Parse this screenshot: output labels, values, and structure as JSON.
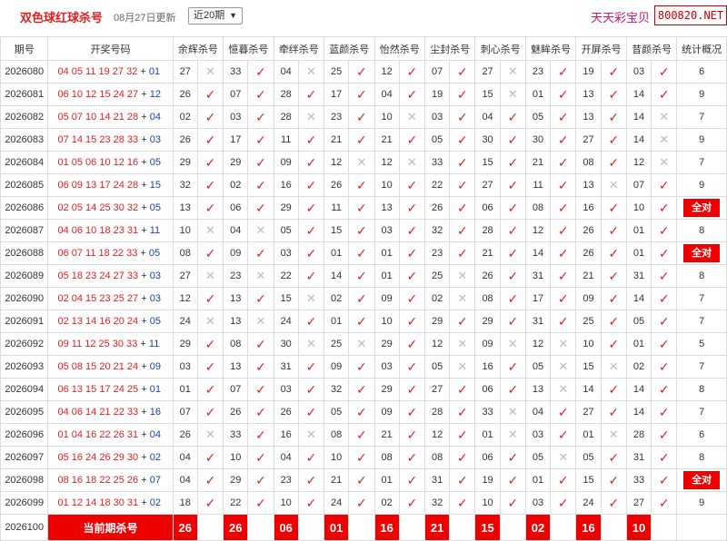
{
  "header": {
    "title": "双色球红球杀号",
    "updated": "08月27日更新",
    "range_selected": "近20期",
    "brand": "天天彩宝贝",
    "site": "800820.NET"
  },
  "columns": {
    "issue": "期号",
    "draw": "开奖号码",
    "experts": [
      "余辉杀号",
      "憶暮杀号",
      "牵绊杀号",
      "蓝颜杀号",
      "怡然杀号",
      "尘封杀号",
      "刺心杀号",
      "魅眸杀号",
      "开屏杀号",
      "昔颜杀号"
    ],
    "stat": "统计概况"
  },
  "rows": [
    {
      "issue": "2026080",
      "red": "04 05 11 19 27 32",
      "blue": "01",
      "kills": [
        [
          "27",
          "x"
        ],
        [
          "33",
          "v"
        ],
        [
          "04",
          "x"
        ],
        [
          "25",
          "v"
        ],
        [
          "12",
          "v"
        ],
        [
          "07",
          "v"
        ],
        [
          "27",
          "x"
        ],
        [
          "23",
          "v"
        ],
        [
          "19",
          "v"
        ],
        [
          "03",
          "v"
        ]
      ],
      "stat": "6"
    },
    {
      "issue": "2026081",
      "red": "06 10 12 15 24 27",
      "blue": "12",
      "kills": [
        [
          "26",
          "v"
        ],
        [
          "07",
          "v"
        ],
        [
          "28",
          "v"
        ],
        [
          "17",
          "v"
        ],
        [
          "04",
          "v"
        ],
        [
          "19",
          "v"
        ],
        [
          "15",
          "x"
        ],
        [
          "01",
          "v"
        ],
        [
          "13",
          "v"
        ],
        [
          "14",
          "v"
        ]
      ],
      "stat": "9"
    },
    {
      "issue": "2026082",
      "red": "05 07 10 14 21 28",
      "blue": "04",
      "kills": [
        [
          "02",
          "v"
        ],
        [
          "03",
          "v"
        ],
        [
          "28",
          "x"
        ],
        [
          "23",
          "v"
        ],
        [
          "10",
          "x"
        ],
        [
          "03",
          "v"
        ],
        [
          "04",
          "v"
        ],
        [
          "05",
          "v"
        ],
        [
          "13",
          "v"
        ],
        [
          "14",
          "x"
        ]
      ],
      "stat": "7"
    },
    {
      "issue": "2026083",
      "red": "07 14 15 23 28 33",
      "blue": "03",
      "kills": [
        [
          "26",
          "v"
        ],
        [
          "17",
          "v"
        ],
        [
          "11",
          "v"
        ],
        [
          "21",
          "v"
        ],
        [
          "21",
          "v"
        ],
        [
          "05",
          "v"
        ],
        [
          "30",
          "v"
        ],
        [
          "30",
          "v"
        ],
        [
          "27",
          "v"
        ],
        [
          "14",
          "x"
        ]
      ],
      "stat": "9"
    },
    {
      "issue": "2026084",
      "red": "01 05 06 10 12 16",
      "blue": "05",
      "kills": [
        [
          "29",
          "v"
        ],
        [
          "29",
          "v"
        ],
        [
          "09",
          "v"
        ],
        [
          "12",
          "x"
        ],
        [
          "12",
          "x"
        ],
        [
          "33",
          "v"
        ],
        [
          "15",
          "v"
        ],
        [
          "21",
          "v"
        ],
        [
          "08",
          "v"
        ],
        [
          "12",
          "x"
        ]
      ],
      "stat": "7"
    },
    {
      "issue": "2026085",
      "red": "06 09 13 17 24 28",
      "blue": "15",
      "kills": [
        [
          "32",
          "v"
        ],
        [
          "02",
          "v"
        ],
        [
          "16",
          "v"
        ],
        [
          "26",
          "v"
        ],
        [
          "10",
          "v"
        ],
        [
          "22",
          "v"
        ],
        [
          "27",
          "v"
        ],
        [
          "11",
          "v"
        ],
        [
          "13",
          "x"
        ],
        [
          "07",
          "v"
        ]
      ],
      "stat": "9"
    },
    {
      "issue": "2026086",
      "red": "02 05 14 25 30 32",
      "blue": "05",
      "kills": [
        [
          "13",
          "v"
        ],
        [
          "06",
          "v"
        ],
        [
          "29",
          "v"
        ],
        [
          "11",
          "v"
        ],
        [
          "13",
          "v"
        ],
        [
          "26",
          "v"
        ],
        [
          "06",
          "v"
        ],
        [
          "08",
          "v"
        ],
        [
          "16",
          "v"
        ],
        [
          "10",
          "v"
        ]
      ],
      "stat": "全对"
    },
    {
      "issue": "2026087",
      "red": "04 06 10 18 23 31",
      "blue": "11",
      "kills": [
        [
          "10",
          "x"
        ],
        [
          "04",
          "x"
        ],
        [
          "05",
          "v"
        ],
        [
          "15",
          "v"
        ],
        [
          "03",
          "v"
        ],
        [
          "32",
          "v"
        ],
        [
          "28",
          "v"
        ],
        [
          "12",
          "v"
        ],
        [
          "26",
          "v"
        ],
        [
          "01",
          "v"
        ]
      ],
      "stat": "8"
    },
    {
      "issue": "2026088",
      "red": "06 07 11 18 22 33",
      "blue": "05",
      "kills": [
        [
          "08",
          "v"
        ],
        [
          "09",
          "v"
        ],
        [
          "03",
          "v"
        ],
        [
          "01",
          "v"
        ],
        [
          "01",
          "v"
        ],
        [
          "23",
          "v"
        ],
        [
          "21",
          "v"
        ],
        [
          "14",
          "v"
        ],
        [
          "26",
          "v"
        ],
        [
          "01",
          "v"
        ]
      ],
      "stat": "全对"
    },
    {
      "issue": "2026089",
      "red": "05 18 23 24 27 33",
      "blue": "03",
      "kills": [
        [
          "27",
          "x"
        ],
        [
          "23",
          "x"
        ],
        [
          "22",
          "v"
        ],
        [
          "14",
          "v"
        ],
        [
          "01",
          "v"
        ],
        [
          "25",
          "x"
        ],
        [
          "26",
          "v"
        ],
        [
          "31",
          "v"
        ],
        [
          "21",
          "v"
        ],
        [
          "31",
          "v"
        ]
      ],
      "stat": "8"
    },
    {
      "issue": "2026090",
      "red": "02 04 15 23 25 27",
      "blue": "03",
      "kills": [
        [
          "12",
          "v"
        ],
        [
          "13",
          "v"
        ],
        [
          "15",
          "x"
        ],
        [
          "02",
          "v"
        ],
        [
          "09",
          "v"
        ],
        [
          "02",
          "x"
        ],
        [
          "08",
          "v"
        ],
        [
          "17",
          "v"
        ],
        [
          "09",
          "v"
        ],
        [
          "14",
          "v"
        ]
      ],
      "stat": "7"
    },
    {
      "issue": "2026091",
      "red": "02 13 14 16 20 24",
      "blue": "05",
      "kills": [
        [
          "24",
          "x"
        ],
        [
          "13",
          "x"
        ],
        [
          "24",
          "v"
        ],
        [
          "01",
          "v"
        ],
        [
          "10",
          "v"
        ],
        [
          "29",
          "v"
        ],
        [
          "29",
          "v"
        ],
        [
          "31",
          "v"
        ],
        [
          "25",
          "v"
        ],
        [
          "05",
          "v"
        ]
      ],
      "stat": "7"
    },
    {
      "issue": "2026092",
      "red": "09 11 12 25 30 33",
      "blue": "11",
      "kills": [
        [
          "29",
          "v"
        ],
        [
          "08",
          "v"
        ],
        [
          "30",
          "x"
        ],
        [
          "25",
          "x"
        ],
        [
          "29",
          "v"
        ],
        [
          "12",
          "x"
        ],
        [
          "09",
          "x"
        ],
        [
          "12",
          "x"
        ],
        [
          "10",
          "v"
        ],
        [
          "01",
          "v"
        ]
      ],
      "stat": "5"
    },
    {
      "issue": "2026093",
      "red": "05 08 15 20 21 24",
      "blue": "09",
      "kills": [
        [
          "03",
          "v"
        ],
        [
          "13",
          "v"
        ],
        [
          "31",
          "v"
        ],
        [
          "09",
          "v"
        ],
        [
          "03",
          "v"
        ],
        [
          "05",
          "x"
        ],
        [
          "16",
          "v"
        ],
        [
          "05",
          "x"
        ],
        [
          "15",
          "x"
        ],
        [
          "02",
          "v"
        ]
      ],
      "stat": "7"
    },
    {
      "issue": "2026094",
      "red": "06 13 15 17 24 25",
      "blue": "01",
      "kills": [
        [
          "01",
          "v"
        ],
        [
          "07",
          "v"
        ],
        [
          "03",
          "v"
        ],
        [
          "32",
          "v"
        ],
        [
          "29",
          "v"
        ],
        [
          "27",
          "v"
        ],
        [
          "06",
          "v"
        ],
        [
          "13",
          "x"
        ],
        [
          "14",
          "v"
        ],
        [
          "14",
          "v"
        ]
      ],
      "stat": "8"
    },
    {
      "issue": "2026095",
      "red": "04 06 14 21 22 33",
      "blue": "16",
      "kills": [
        [
          "07",
          "v"
        ],
        [
          "26",
          "v"
        ],
        [
          "26",
          "v"
        ],
        [
          "05",
          "v"
        ],
        [
          "09",
          "v"
        ],
        [
          "28",
          "v"
        ],
        [
          "33",
          "x"
        ],
        [
          "04",
          "v"
        ],
        [
          "27",
          "v"
        ],
        [
          "14",
          "v"
        ]
      ],
      "stat": "7"
    },
    {
      "issue": "2026096",
      "red": "01 04 16 22 26 31",
      "blue": "04",
      "kills": [
        [
          "26",
          "x"
        ],
        [
          "33",
          "v"
        ],
        [
          "16",
          "x"
        ],
        [
          "08",
          "v"
        ],
        [
          "21",
          "v"
        ],
        [
          "12",
          "v"
        ],
        [
          "01",
          "x"
        ],
        [
          "03",
          "v"
        ],
        [
          "01",
          "x"
        ],
        [
          "28",
          "v"
        ]
      ],
      "stat": "6"
    },
    {
      "issue": "2026097",
      "red": "05 16 24 26 29 30",
      "blue": "02",
      "kills": [
        [
          "04",
          "v"
        ],
        [
          "10",
          "v"
        ],
        [
          "04",
          "v"
        ],
        [
          "10",
          "v"
        ],
        [
          "08",
          "v"
        ],
        [
          "08",
          "v"
        ],
        [
          "06",
          "v"
        ],
        [
          "05",
          "x"
        ],
        [
          "05",
          "v"
        ],
        [
          "31",
          "v"
        ]
      ],
      "stat": "8"
    },
    {
      "issue": "2026098",
      "red": "08 16 18 22 25 26",
      "blue": "07",
      "kills": [
        [
          "04",
          "v"
        ],
        [
          "29",
          "v"
        ],
        [
          "23",
          "v"
        ],
        [
          "21",
          "v"
        ],
        [
          "01",
          "v"
        ],
        [
          "31",
          "v"
        ],
        [
          "19",
          "v"
        ],
        [
          "01",
          "v"
        ],
        [
          "15",
          "v"
        ],
        [
          "33",
          "v"
        ]
      ],
      "stat": "全对"
    },
    {
      "issue": "2026099",
      "red": "01 12 14 18 30 31",
      "blue": "02",
      "kills": [
        [
          "18",
          "v"
        ],
        [
          "22",
          "v"
        ],
        [
          "10",
          "v"
        ],
        [
          "24",
          "v"
        ],
        [
          "02",
          "v"
        ],
        [
          "32",
          "v"
        ],
        [
          "10",
          "v"
        ],
        [
          "03",
          "v"
        ],
        [
          "24",
          "v"
        ],
        [
          "27",
          "v"
        ]
      ],
      "stat": "9"
    }
  ],
  "current": {
    "issue": "2026100",
    "label": "当前期杀号",
    "kills": [
      "26",
      "26",
      "06",
      "01",
      "16",
      "21",
      "15",
      "02",
      "16",
      "10"
    ]
  }
}
